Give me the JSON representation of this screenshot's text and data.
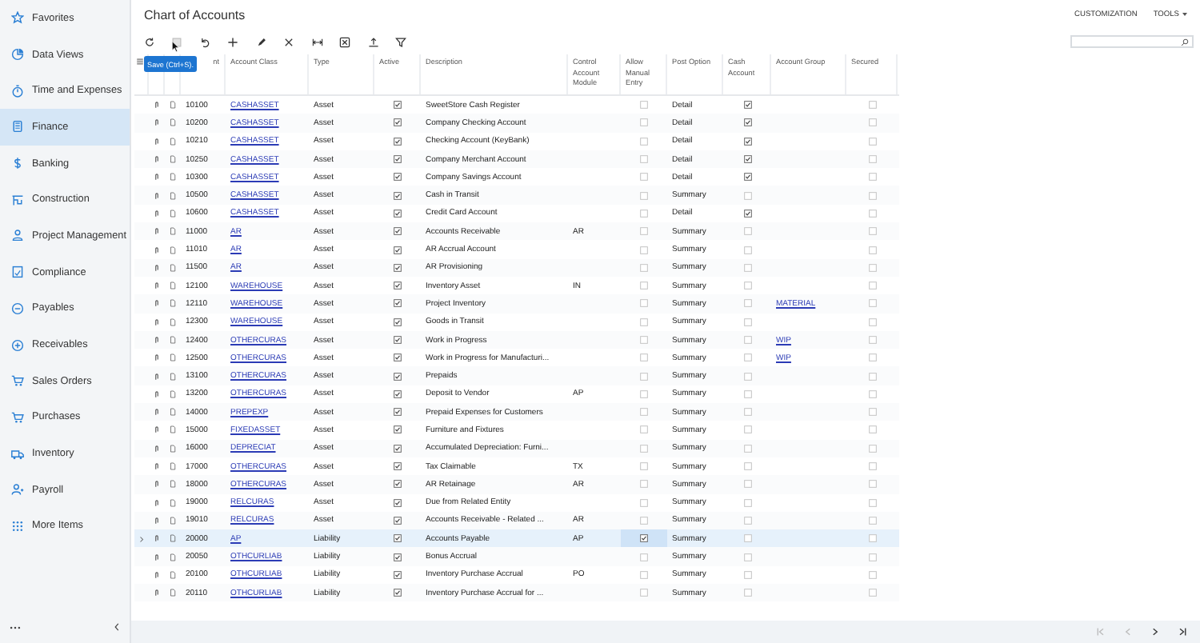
{
  "sidebar": {
    "items": [
      {
        "label": "Favorites",
        "selected": false
      },
      {
        "label": "Data Views",
        "selected": false
      },
      {
        "label": "Time and Expenses",
        "selected": false
      },
      {
        "label": "Finance",
        "selected": true
      },
      {
        "label": "Banking",
        "selected": false
      },
      {
        "label": "Construction",
        "selected": false
      },
      {
        "label": "Project Management",
        "selected": false
      },
      {
        "label": "Compliance",
        "selected": false
      },
      {
        "label": "Payables",
        "selected": false
      },
      {
        "label": "Receivables",
        "selected": false
      },
      {
        "label": "Sales Orders",
        "selected": false
      },
      {
        "label": "Purchases",
        "selected": false
      },
      {
        "label": "Inventory",
        "selected": false
      },
      {
        "label": "Payroll",
        "selected": false
      },
      {
        "label": "More Items",
        "selected": false
      }
    ]
  },
  "page": {
    "title": "Chart of Accounts",
    "menu": [
      {
        "label": "CUSTOMIZATION",
        "kind": "link"
      },
      {
        "label": "TOOLS",
        "kind": "dropdown"
      }
    ]
  },
  "tooltip": "Save (Ctrl+S).",
  "table": {
    "columns": [
      "nt",
      "Account Class",
      "Type",
      "Active",
      "Description",
      "Control Account Module",
      "Allow Manual Entry",
      "Post Option",
      "Cash Account",
      "Account Group",
      "Secured"
    ],
    "rows": [
      {
        "account": "10100",
        "account_class": "CASHASSET",
        "type": "Asset",
        "active": true,
        "description": "SweetStore Cash Register",
        "manual_entry": false,
        "post_option": "Detail",
        "cash_account": true,
        "secured": false,
        "selected": false
      },
      {
        "account": "10200",
        "account_class": "CASHASSET",
        "type": "Asset",
        "active": true,
        "description": "Company Checking Account",
        "manual_entry": false,
        "post_option": "Detail",
        "cash_account": true,
        "secured": false,
        "selected": false
      },
      {
        "account": "10210",
        "account_class": "CASHASSET",
        "type": "Asset",
        "active": true,
        "description": "Checking Account (KeyBank)",
        "manual_entry": false,
        "post_option": "Detail",
        "cash_account": true,
        "secured": false,
        "selected": false
      },
      {
        "account": "10250",
        "account_class": "CASHASSET",
        "type": "Asset",
        "active": true,
        "description": "Company Merchant Account",
        "manual_entry": false,
        "post_option": "Detail",
        "cash_account": true,
        "secured": false,
        "selected": false
      },
      {
        "account": "10300",
        "account_class": "CASHASSET",
        "type": "Asset",
        "active": true,
        "description": "Company Savings Account",
        "manual_entry": false,
        "post_option": "Detail",
        "cash_account": true,
        "secured": false,
        "selected": false
      },
      {
        "account": "10500",
        "account_class": "CASHASSET",
        "type": "Asset",
        "active": true,
        "description": "Cash in Transit",
        "manual_entry": false,
        "post_option": "Summary",
        "cash_account": false,
        "secured": false,
        "selected": false
      },
      {
        "account": "10600",
        "account_class": "CASHASSET",
        "type": "Asset",
        "active": true,
        "description": "Credit Card Account",
        "manual_entry": false,
        "post_option": "Detail",
        "cash_account": true,
        "secured": false,
        "selected": false
      },
      {
        "account": "11000",
        "account_class": "AR",
        "type": "Asset",
        "active": true,
        "description": "Accounts Receivable",
        "control_module": "AR",
        "manual_entry": false,
        "post_option": "Summary",
        "cash_account": false,
        "secured": false,
        "selected": false
      },
      {
        "account": "11010",
        "account_class": "AR",
        "type": "Asset",
        "active": true,
        "description": "AR Accrual Account",
        "manual_entry": false,
        "post_option": "Summary",
        "cash_account": false,
        "secured": false,
        "selected": false
      },
      {
        "account": "11500",
        "account_class": "AR",
        "type": "Asset",
        "active": true,
        "description": "AR Provisioning",
        "manual_entry": false,
        "post_option": "Summary",
        "cash_account": false,
        "secured": false,
        "selected": false
      },
      {
        "account": "12100",
        "account_class": "WAREHOUSE",
        "type": "Asset",
        "active": true,
        "description": "Inventory Asset",
        "control_module": "IN",
        "manual_entry": false,
        "post_option": "Summary",
        "cash_account": false,
        "secured": false,
        "selected": false
      },
      {
        "account": "12110",
        "account_class": "WAREHOUSE",
        "type": "Asset",
        "active": true,
        "description": "Project Inventory",
        "manual_entry": false,
        "post_option": "Summary",
        "cash_account": false,
        "account_group": "MATERIAL",
        "secured": false,
        "selected": false
      },
      {
        "account": "12300",
        "account_class": "WAREHOUSE",
        "type": "Asset",
        "active": true,
        "description": "Goods in Transit",
        "manual_entry": false,
        "post_option": "Summary",
        "cash_account": false,
        "secured": false,
        "selected": false
      },
      {
        "account": "12400",
        "account_class": "OTHERCURAS",
        "type": "Asset",
        "active": true,
        "description": "Work in Progress",
        "manual_entry": false,
        "post_option": "Summary",
        "cash_account": false,
        "account_group": "WIP",
        "secured": false,
        "selected": false
      },
      {
        "account": "12500",
        "account_class": "OTHERCURAS",
        "type": "Asset",
        "active": true,
        "description": "Work in Progress for Manufacturi...",
        "manual_entry": false,
        "post_option": "Summary",
        "cash_account": false,
        "account_group": "WIP",
        "secured": false,
        "selected": false
      },
      {
        "account": "13100",
        "account_class": "OTHERCURAS",
        "type": "Asset",
        "active": true,
        "description": "Prepaids",
        "manual_entry": false,
        "post_option": "Summary",
        "cash_account": false,
        "secured": false,
        "selected": false
      },
      {
        "account": "13200",
        "account_class": "OTHERCURAS",
        "type": "Asset",
        "active": true,
        "description": "Deposit to Vendor",
        "control_module": "AP",
        "manual_entry": false,
        "post_option": "Summary",
        "cash_account": false,
        "secured": false,
        "selected": false
      },
      {
        "account": "14000",
        "account_class": "PREPEXP",
        "type": "Asset",
        "active": true,
        "description": "Prepaid Expenses for Customers",
        "manual_entry": false,
        "post_option": "Summary",
        "cash_account": false,
        "secured": false,
        "selected": false
      },
      {
        "account": "15000",
        "account_class": "FIXEDASSET",
        "type": "Asset",
        "active": true,
        "description": "Furniture and Fixtures",
        "manual_entry": false,
        "post_option": "Summary",
        "cash_account": false,
        "secured": false,
        "selected": false
      },
      {
        "account": "16000",
        "account_class": "DEPRECIAT",
        "type": "Asset",
        "active": true,
        "description": "Accumulated Depreciation: Furni...",
        "manual_entry": false,
        "post_option": "Summary",
        "cash_account": false,
        "secured": false,
        "selected": false
      },
      {
        "account": "17000",
        "account_class": "OTHERCURAS",
        "type": "Asset",
        "active": true,
        "description": "Tax Claimable",
        "control_module": "TX",
        "manual_entry": false,
        "post_option": "Summary",
        "cash_account": false,
        "secured": false,
        "selected": false
      },
      {
        "account": "18000",
        "account_class": "OTHERCURAS",
        "type": "Asset",
        "active": true,
        "description": "AR Retainage",
        "control_module": "AR",
        "manual_entry": false,
        "post_option": "Summary",
        "cash_account": false,
        "secured": false,
        "selected": false
      },
      {
        "account": "19000",
        "account_class": "RELCURAS",
        "type": "Asset",
        "active": true,
        "description": "Due from Related Entity",
        "manual_entry": false,
        "post_option": "Summary",
        "cash_account": false,
        "secured": false,
        "selected": false
      },
      {
        "account": "19010",
        "account_class": "RELCURAS",
        "type": "Asset",
        "active": true,
        "description": "Accounts Receivable - Related ...",
        "control_module": "AR",
        "manual_entry": false,
        "post_option": "Summary",
        "cash_account": false,
        "secured": false,
        "selected": false
      },
      {
        "account": "20000",
        "account_class": "AP",
        "type": "Liability",
        "active": true,
        "description": "Accounts Payable",
        "control_module": "AP",
        "manual_entry": true,
        "post_option": "Summary",
        "cash_account": false,
        "secured": false,
        "selected": true
      },
      {
        "account": "20050",
        "account_class": "OTHCURLIAB",
        "type": "Liability",
        "active": true,
        "description": "Bonus Accrual",
        "manual_entry": false,
        "post_option": "Summary",
        "cash_account": false,
        "secured": false,
        "selected": false
      },
      {
        "account": "20100",
        "account_class": "OTHCURLIAB",
        "type": "Liability",
        "active": true,
        "description": "Inventory Purchase Accrual",
        "control_module": "PO",
        "manual_entry": false,
        "post_option": "Summary",
        "cash_account": false,
        "secured": false,
        "selected": false
      },
      {
        "account": "20110",
        "account_class": "OTHCURLIAB",
        "type": "Liability",
        "active": true,
        "description": "Inventory Purchase Accrual for ...",
        "manual_entry": false,
        "post_option": "Summary",
        "cash_account": false,
        "secured": false,
        "selected": false
      }
    ]
  }
}
